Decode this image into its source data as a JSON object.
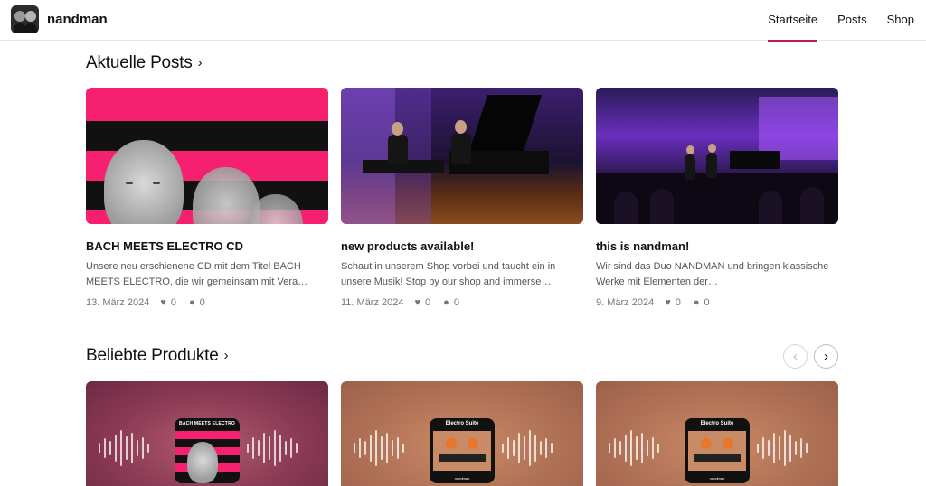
{
  "header": {
    "site_name": "nandman",
    "nav": [
      {
        "label": "Startseite",
        "active": true
      },
      {
        "label": "Posts",
        "active": false
      },
      {
        "label": "Shop",
        "active": false
      }
    ],
    "accent_color": "#c2185b"
  },
  "posts_section": {
    "title": "Aktuelle Posts",
    "chevron": "›",
    "posts": [
      {
        "title": "BACH MEETS ELECTRO CD",
        "excerpt": "Unsere neu erschienene CD mit dem Titel BACH MEETS ELECTRO, die wir gemeinsam mit Vera…",
        "date": "13. März 2024",
        "likes": "0",
        "comments": "0"
      },
      {
        "title": "new products available!",
        "excerpt": "Schaut in unserem Shop vorbei und taucht ein in unsere Musik! Stop by our shop and immerse…",
        "date": "11. März 2024",
        "likes": "0",
        "comments": "0"
      },
      {
        "title": "this is nandman!",
        "excerpt": "Wir sind das Duo NANDMAN und bringen klassische Werke mit Elementen der…",
        "date": "9. März 2024",
        "likes": "0",
        "comments": "0"
      }
    ]
  },
  "products_section": {
    "title": "Beliebte Produkte",
    "chevron": "›",
    "prev_arrow": "‹",
    "next_arrow": "›",
    "products": [
      {
        "album_title": "BACH MEETS ELECTRO"
      },
      {
        "album_title": "Electro Suite",
        "album_footer": "nandman"
      },
      {
        "album_title": "Electro Suite",
        "album_footer": "nandman"
      }
    ]
  }
}
